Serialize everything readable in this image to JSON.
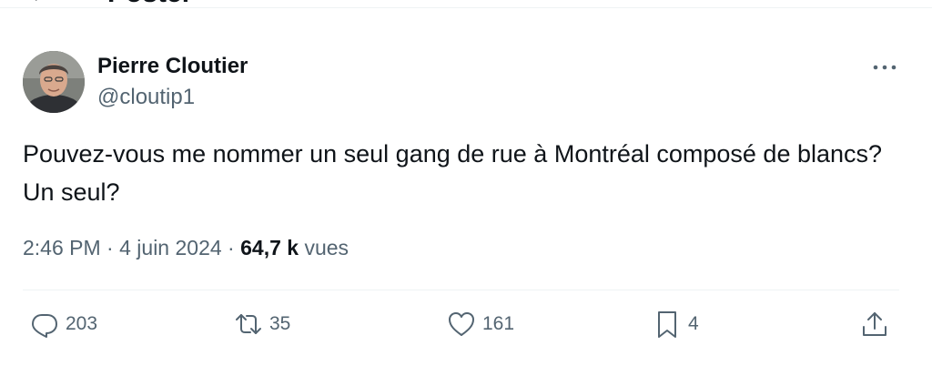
{
  "header": {
    "title": "Poster"
  },
  "author": {
    "name": "Pierre Cloutier",
    "handle": "@cloutip1"
  },
  "tweet": {
    "text": "Pouvez-vous me nommer un seul gang de rue à Montréal composé de blancs? Un seul?",
    "time": "2:46 PM",
    "separator1": "·",
    "date": "4 juin 2024",
    "separator2": "·",
    "views_count": "64,7 k",
    "views_label": "vues"
  },
  "actions": {
    "replies": "203",
    "reposts": "35",
    "likes": "161",
    "bookmarks": "4"
  },
  "colors": {
    "text_primary": "#0f1419",
    "text_secondary": "#536471",
    "divider": "#eff3f4"
  },
  "icons": [
    "back-arrow-icon",
    "more-icon",
    "reply-icon",
    "repost-icon",
    "like-icon",
    "bookmark-icon",
    "share-icon"
  ]
}
